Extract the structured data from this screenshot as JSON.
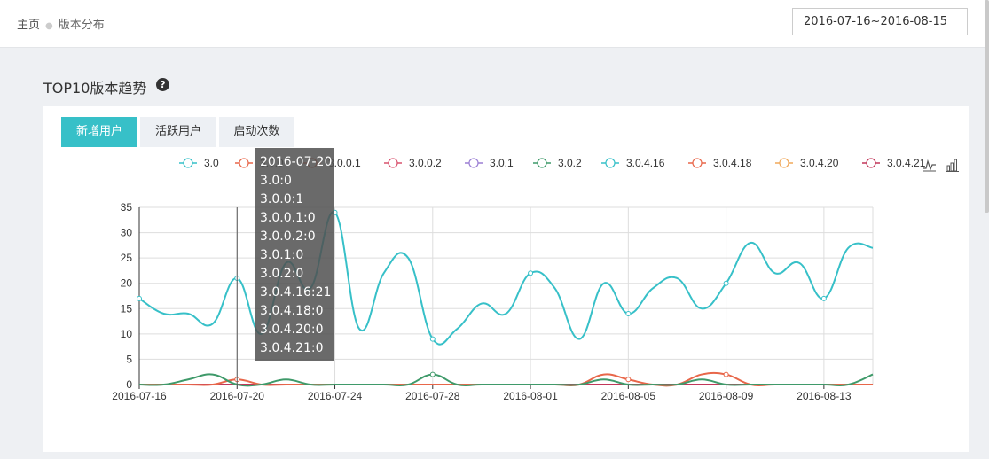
{
  "breadcrumb": {
    "home": "主页",
    "current": "版本分布"
  },
  "date_range": "2016-07-16~2016-08-15",
  "section": {
    "title": "TOP10版本趋势"
  },
  "tabs": [
    {
      "label": "新增用户",
      "active": true
    },
    {
      "label": "活跃用户",
      "active": false
    },
    {
      "label": "启动次数",
      "active": false
    }
  ],
  "tooltip": {
    "date": "2016-07-20",
    "lines": [
      "3.0:0",
      "3.0.0:1",
      "3.0.0.1:0",
      "3.0.0.2:0",
      "3.0.1:0",
      "3.0.2:0",
      "3.0.4.16:21",
      "3.0.4.18:0",
      "3.0.4.20:0",
      "3.0.4.21:0"
    ]
  },
  "toolbox": {
    "line_icon": "line-chart-icon",
    "bar_icon": "bar-chart-icon"
  },
  "chart_data": {
    "type": "line",
    "x": [
      "2016-07-16",
      "2016-07-17",
      "2016-07-18",
      "2016-07-19",
      "2016-07-20",
      "2016-07-21",
      "2016-07-22",
      "2016-07-23",
      "2016-07-24",
      "2016-07-25",
      "2016-07-26",
      "2016-07-27",
      "2016-07-28",
      "2016-07-29",
      "2016-07-30",
      "2016-07-31",
      "2016-08-01",
      "2016-08-02",
      "2016-08-03",
      "2016-08-04",
      "2016-08-05",
      "2016-08-06",
      "2016-08-07",
      "2016-08-08",
      "2016-08-09",
      "2016-08-10",
      "2016-08-11",
      "2016-08-12",
      "2016-08-13",
      "2016-08-14",
      "2016-08-15"
    ],
    "xticks": [
      "2016-07-16",
      "2016-07-20",
      "2016-07-24",
      "2016-07-28",
      "2016-08-01",
      "2016-08-05",
      "2016-08-09",
      "2016-08-13"
    ],
    "ylim": [
      0,
      35
    ],
    "yticks": [
      0,
      5,
      10,
      15,
      20,
      25,
      30,
      35
    ],
    "grid": true,
    "legend_position": "top",
    "series": [
      {
        "name": "3.0",
        "color": "#37c0c8",
        "values": [
          0,
          0,
          0,
          0,
          0,
          0,
          0,
          0,
          0,
          0,
          0,
          0,
          0,
          0,
          0,
          0,
          0,
          0,
          0,
          0,
          0,
          0,
          0,
          0,
          0,
          0,
          0,
          0,
          0,
          0,
          0
        ]
      },
      {
        "name": "3.0.0",
        "color": "#e8674a",
        "values": [
          0,
          0,
          0,
          0,
          1,
          0,
          0,
          0,
          0,
          0,
          0,
          0,
          0,
          0,
          0,
          0,
          0,
          0,
          0,
          2,
          1,
          0,
          0,
          2,
          2,
          0,
          0,
          0,
          0,
          0,
          0
        ]
      },
      {
        "name": "3.0.0.1",
        "color": "#e8674a",
        "values": [
          0,
          0,
          0,
          0,
          0,
          0,
          0,
          0,
          0,
          0,
          0,
          0,
          0,
          0,
          0,
          0,
          0,
          0,
          0,
          0,
          0,
          0,
          0,
          0,
          0,
          0,
          0,
          0,
          0,
          0,
          0
        ]
      },
      {
        "name": "3.0.0.2",
        "color": "#d9536f",
        "values": [
          0,
          0,
          0,
          0,
          0,
          0,
          0,
          0,
          0,
          0,
          0,
          0,
          0,
          0,
          0,
          0,
          0,
          0,
          0,
          0,
          0,
          0,
          0,
          0,
          0,
          0,
          0,
          0,
          0,
          0,
          0
        ]
      },
      {
        "name": "3.0.1",
        "color": "#9b7fd4",
        "values": [
          0,
          0,
          0,
          0,
          0,
          0,
          0,
          0,
          0,
          0,
          0,
          0,
          0,
          0,
          0,
          0,
          0,
          0,
          0,
          0,
          0,
          0,
          0,
          0,
          0,
          0,
          0,
          0,
          0,
          0,
          0
        ]
      },
      {
        "name": "3.0.2",
        "color": "#3f9a6a",
        "values": [
          0,
          0,
          1,
          2,
          0,
          0,
          1,
          0,
          0,
          0,
          0,
          0,
          2,
          0,
          0,
          0,
          0,
          0,
          0,
          1,
          0,
          0,
          0,
          1,
          0,
          0,
          0,
          0,
          0,
          0,
          2
        ]
      },
      {
        "name": "3.0.4.16",
        "color": "#37c0c8",
        "values": [
          17,
          14,
          14,
          12,
          21,
          10,
          24,
          19,
          34,
          11,
          22,
          25,
          9,
          11,
          16,
          14,
          22,
          19,
          9,
          20,
          14,
          19,
          21,
          15,
          20,
          28,
          22,
          24,
          17,
          27,
          27
        ]
      },
      {
        "name": "3.0.4.18",
        "color": "#e8674a",
        "values": [
          0,
          0,
          0,
          0,
          0,
          0,
          0,
          0,
          0,
          0,
          0,
          0,
          0,
          0,
          0,
          0,
          0,
          0,
          0,
          0,
          0,
          0,
          0,
          0,
          0,
          0,
          0,
          0,
          0,
          0,
          0
        ]
      },
      {
        "name": "3.0.4.20",
        "color": "#f0a85a",
        "values": [
          0,
          0,
          0,
          0,
          0,
          0,
          0,
          0,
          0,
          0,
          0,
          0,
          0,
          0,
          0,
          0,
          0,
          0,
          0,
          0,
          0,
          0,
          0,
          0,
          0,
          0,
          0,
          0,
          0,
          0,
          0
        ]
      },
      {
        "name": "3.0.4.21",
        "color": "#c2375a",
        "values": [
          0,
          0,
          0,
          0,
          0,
          0,
          0,
          0,
          0,
          0,
          0,
          0,
          0,
          0,
          0,
          0,
          0,
          0,
          0,
          0,
          0,
          0,
          0,
          0,
          0,
          0,
          0,
          0,
          0,
          0,
          0
        ]
      }
    ]
  }
}
